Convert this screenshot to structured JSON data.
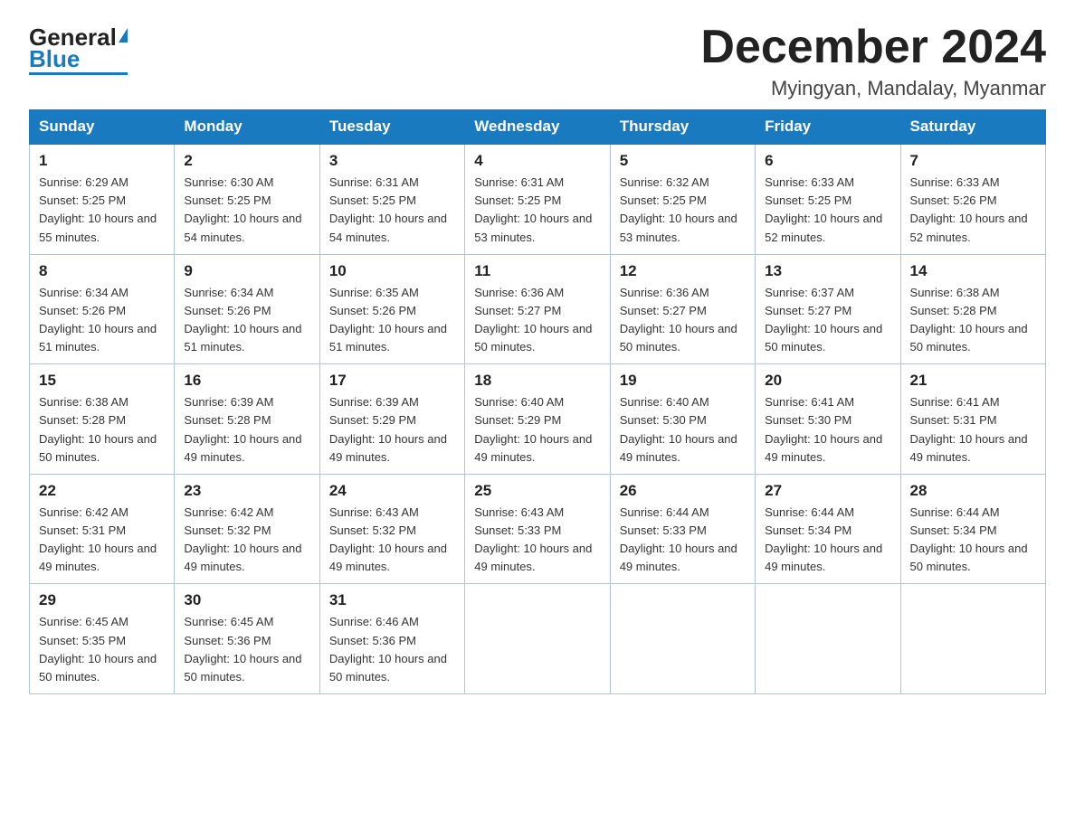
{
  "logo": {
    "general": "General",
    "blue": "Blue",
    "tagline": ""
  },
  "title": "December 2024",
  "subtitle": "Myingyan, Mandalay, Myanmar",
  "weekdays": [
    "Sunday",
    "Monday",
    "Tuesday",
    "Wednesday",
    "Thursday",
    "Friday",
    "Saturday"
  ],
  "weeks": [
    [
      {
        "day": "1",
        "sunrise": "6:29 AM",
        "sunset": "5:25 PM",
        "daylight": "10 hours and 55 minutes."
      },
      {
        "day": "2",
        "sunrise": "6:30 AM",
        "sunset": "5:25 PM",
        "daylight": "10 hours and 54 minutes."
      },
      {
        "day": "3",
        "sunrise": "6:31 AM",
        "sunset": "5:25 PM",
        "daylight": "10 hours and 54 minutes."
      },
      {
        "day": "4",
        "sunrise": "6:31 AM",
        "sunset": "5:25 PM",
        "daylight": "10 hours and 53 minutes."
      },
      {
        "day": "5",
        "sunrise": "6:32 AM",
        "sunset": "5:25 PM",
        "daylight": "10 hours and 53 minutes."
      },
      {
        "day": "6",
        "sunrise": "6:33 AM",
        "sunset": "5:25 PM",
        "daylight": "10 hours and 52 minutes."
      },
      {
        "day": "7",
        "sunrise": "6:33 AM",
        "sunset": "5:26 PM",
        "daylight": "10 hours and 52 minutes."
      }
    ],
    [
      {
        "day": "8",
        "sunrise": "6:34 AM",
        "sunset": "5:26 PM",
        "daylight": "10 hours and 51 minutes."
      },
      {
        "day": "9",
        "sunrise": "6:34 AM",
        "sunset": "5:26 PM",
        "daylight": "10 hours and 51 minutes."
      },
      {
        "day": "10",
        "sunrise": "6:35 AM",
        "sunset": "5:26 PM",
        "daylight": "10 hours and 51 minutes."
      },
      {
        "day": "11",
        "sunrise": "6:36 AM",
        "sunset": "5:27 PM",
        "daylight": "10 hours and 50 minutes."
      },
      {
        "day": "12",
        "sunrise": "6:36 AM",
        "sunset": "5:27 PM",
        "daylight": "10 hours and 50 minutes."
      },
      {
        "day": "13",
        "sunrise": "6:37 AM",
        "sunset": "5:27 PM",
        "daylight": "10 hours and 50 minutes."
      },
      {
        "day": "14",
        "sunrise": "6:38 AM",
        "sunset": "5:28 PM",
        "daylight": "10 hours and 50 minutes."
      }
    ],
    [
      {
        "day": "15",
        "sunrise": "6:38 AM",
        "sunset": "5:28 PM",
        "daylight": "10 hours and 50 minutes."
      },
      {
        "day": "16",
        "sunrise": "6:39 AM",
        "sunset": "5:28 PM",
        "daylight": "10 hours and 49 minutes."
      },
      {
        "day": "17",
        "sunrise": "6:39 AM",
        "sunset": "5:29 PM",
        "daylight": "10 hours and 49 minutes."
      },
      {
        "day": "18",
        "sunrise": "6:40 AM",
        "sunset": "5:29 PM",
        "daylight": "10 hours and 49 minutes."
      },
      {
        "day": "19",
        "sunrise": "6:40 AM",
        "sunset": "5:30 PM",
        "daylight": "10 hours and 49 minutes."
      },
      {
        "day": "20",
        "sunrise": "6:41 AM",
        "sunset": "5:30 PM",
        "daylight": "10 hours and 49 minutes."
      },
      {
        "day": "21",
        "sunrise": "6:41 AM",
        "sunset": "5:31 PM",
        "daylight": "10 hours and 49 minutes."
      }
    ],
    [
      {
        "day": "22",
        "sunrise": "6:42 AM",
        "sunset": "5:31 PM",
        "daylight": "10 hours and 49 minutes."
      },
      {
        "day": "23",
        "sunrise": "6:42 AM",
        "sunset": "5:32 PM",
        "daylight": "10 hours and 49 minutes."
      },
      {
        "day": "24",
        "sunrise": "6:43 AM",
        "sunset": "5:32 PM",
        "daylight": "10 hours and 49 minutes."
      },
      {
        "day": "25",
        "sunrise": "6:43 AM",
        "sunset": "5:33 PM",
        "daylight": "10 hours and 49 minutes."
      },
      {
        "day": "26",
        "sunrise": "6:44 AM",
        "sunset": "5:33 PM",
        "daylight": "10 hours and 49 minutes."
      },
      {
        "day": "27",
        "sunrise": "6:44 AM",
        "sunset": "5:34 PM",
        "daylight": "10 hours and 49 minutes."
      },
      {
        "day": "28",
        "sunrise": "6:44 AM",
        "sunset": "5:34 PM",
        "daylight": "10 hours and 50 minutes."
      }
    ],
    [
      {
        "day": "29",
        "sunrise": "6:45 AM",
        "sunset": "5:35 PM",
        "daylight": "10 hours and 50 minutes."
      },
      {
        "day": "30",
        "sunrise": "6:45 AM",
        "sunset": "5:36 PM",
        "daylight": "10 hours and 50 minutes."
      },
      {
        "day": "31",
        "sunrise": "6:46 AM",
        "sunset": "5:36 PM",
        "daylight": "10 hours and 50 minutes."
      },
      null,
      null,
      null,
      null
    ]
  ]
}
